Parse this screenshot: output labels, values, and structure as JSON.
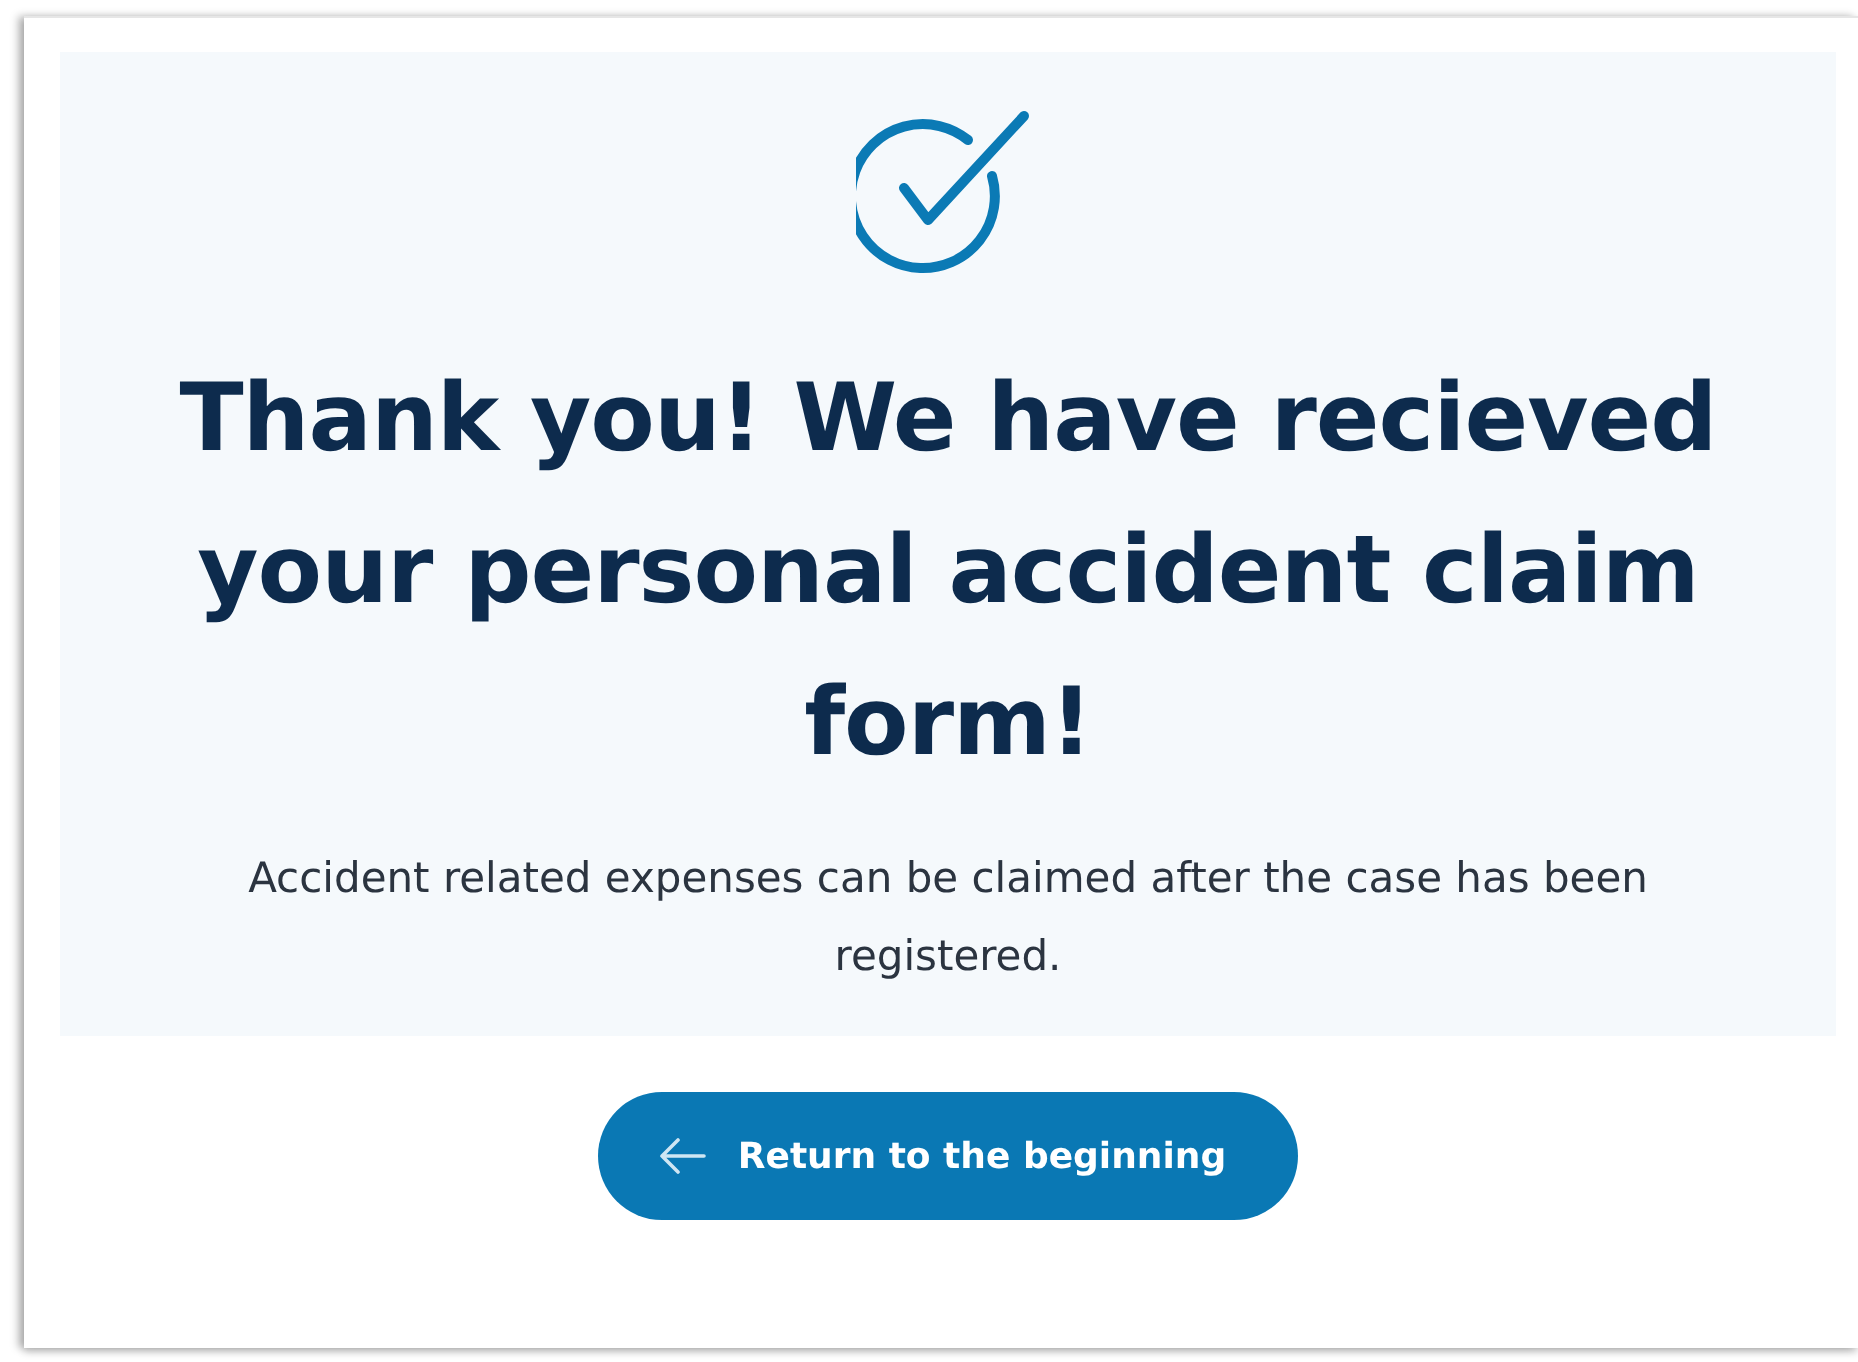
{
  "heading": "Thank you! We have recieved your personal accident claim form!",
  "message": "Accident related expenses can be claimed after the case has been registered.",
  "button": {
    "label": "Return to the beginning"
  }
}
